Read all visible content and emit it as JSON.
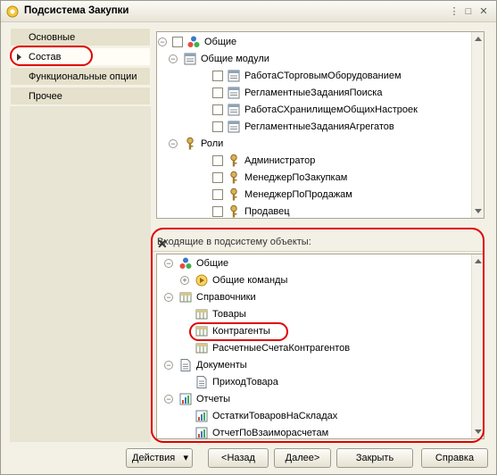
{
  "window": {
    "title": "Подсистема Закупки",
    "controls": [
      "⋮",
      "□",
      "✕"
    ]
  },
  "sidebar": {
    "items": [
      {
        "label": "Основные",
        "active": false
      },
      {
        "label": "Состав",
        "active": true
      },
      {
        "label": "Функциональные опции",
        "active": false
      },
      {
        "label": "Прочее",
        "active": false
      }
    ]
  },
  "upper_tree": {
    "rows": [
      {
        "label": "Общие",
        "icon": "general-icon",
        "toggle": "⊖",
        "checkbox": true,
        "level": 0
      },
      {
        "label": "Общие модули",
        "icon": "module-icon",
        "toggle": "⊖",
        "checkbox": false,
        "level": 1
      },
      {
        "label": "РаботаСТорговымОборудованием",
        "icon": "module-icon",
        "checkbox": true,
        "level": 2
      },
      {
        "label": "РегламентныеЗаданияПоиска",
        "icon": "module-icon",
        "checkbox": true,
        "level": 2
      },
      {
        "label": "РаботаСХранилищемОбщихНастроек",
        "icon": "module-icon",
        "checkbox": true,
        "level": 2
      },
      {
        "label": "РегламентныеЗаданияАгрегатов",
        "icon": "module-icon",
        "checkbox": true,
        "level": 2
      },
      {
        "label": "Роли",
        "icon": "role-icon",
        "toggle": "⊖",
        "checkbox": false,
        "level": 1
      },
      {
        "label": "Администратор",
        "icon": "role-icon",
        "checkbox": true,
        "level": 2
      },
      {
        "label": "МенеджерПоЗакупкам",
        "icon": "role-icon",
        "checkbox": true,
        "level": 2
      },
      {
        "label": "МенеджерПоПродажам",
        "icon": "role-icon",
        "checkbox": true,
        "level": 2
      },
      {
        "label": "Продавец",
        "icon": "role-icon",
        "checkbox": true,
        "level": 2
      }
    ]
  },
  "lower_panel": {
    "header": "Входящие в подсистему объекты:",
    "close": "✕"
  },
  "lower_tree": {
    "rows": [
      {
        "label": "Общие",
        "icon": "general-icon",
        "toggle": "⊖",
        "level": 0
      },
      {
        "label": "Общие команды",
        "icon": "command-icon",
        "toggle": "⊕",
        "level": 1
      },
      {
        "label": "Справочники",
        "icon": "catalog-icon",
        "toggle": "⊖",
        "level": 0
      },
      {
        "label": "Товары",
        "icon": "catalog-icon",
        "level": 1
      },
      {
        "label": "Контрагенты",
        "icon": "catalog-icon",
        "level": 1
      },
      {
        "label": "РасчетныеСчетаКонтрагентов",
        "icon": "catalog-icon",
        "level": 1
      },
      {
        "label": "Документы",
        "icon": "document-icon",
        "toggle": "⊖",
        "level": 0
      },
      {
        "label": "ПриходТовара",
        "icon": "document-icon",
        "level": 1
      },
      {
        "label": "Отчеты",
        "icon": "report-icon",
        "toggle": "⊖",
        "level": 0
      },
      {
        "label": "ОстаткиТоваровНаСкладах",
        "icon": "report-icon",
        "level": 1
      },
      {
        "label": "ОтчетПоВзаиморасчетам",
        "icon": "report-icon",
        "level": 1
      }
    ]
  },
  "buttons": {
    "actions": "Действия",
    "actions_arrow": "▾",
    "back": "<Назад",
    "next": "Далее>",
    "close": "Закрыть",
    "help": "Справка"
  },
  "colors": {
    "highlight_ring": "#e00000",
    "accent_orange": "#f0a030"
  }
}
